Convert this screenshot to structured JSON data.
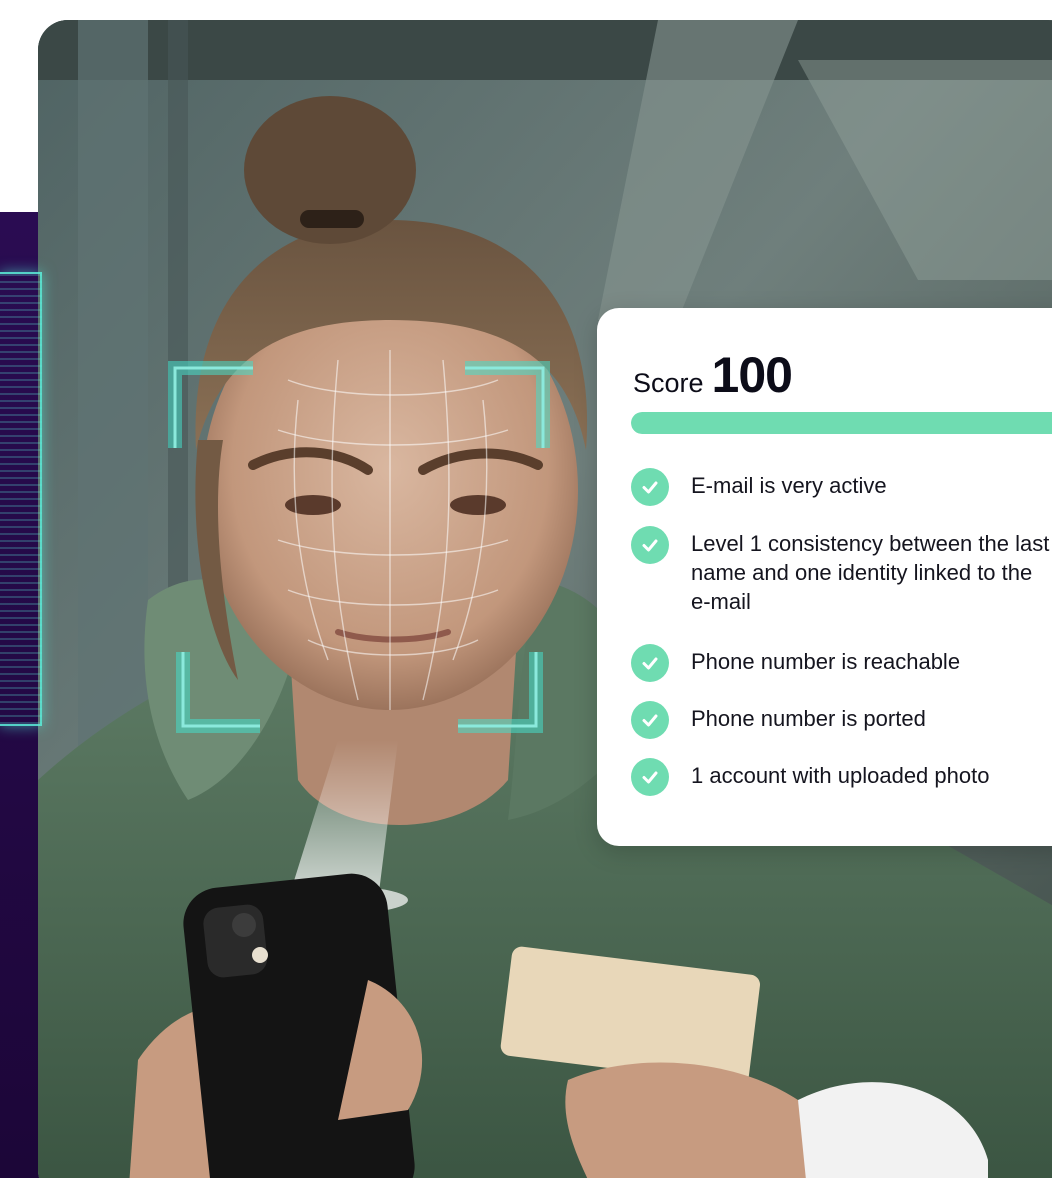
{
  "score": {
    "label": "Score",
    "value": "100",
    "progress_fraction": 1.0
  },
  "checks": [
    {
      "text": "E-mail is very active",
      "icon": "check-circle-icon"
    },
    {
      "text": "Level 1 consistency between the last name and one identity linked to the e-mail",
      "icon": "check-circle-icon"
    },
    {
      "text": "Phone number is reachable",
      "icon": "check-circle-icon"
    },
    {
      "text": "Phone number is ported",
      "icon": "check-circle-icon"
    },
    {
      "text": "1 account with uploaded photo",
      "icon": "check-circle-icon"
    }
  ],
  "colors": {
    "accent_green": "#6fdcb1",
    "scan_cyan": "#5aebd7",
    "purple_panel": "#2a0c52",
    "text_dark": "#0c0c18"
  }
}
